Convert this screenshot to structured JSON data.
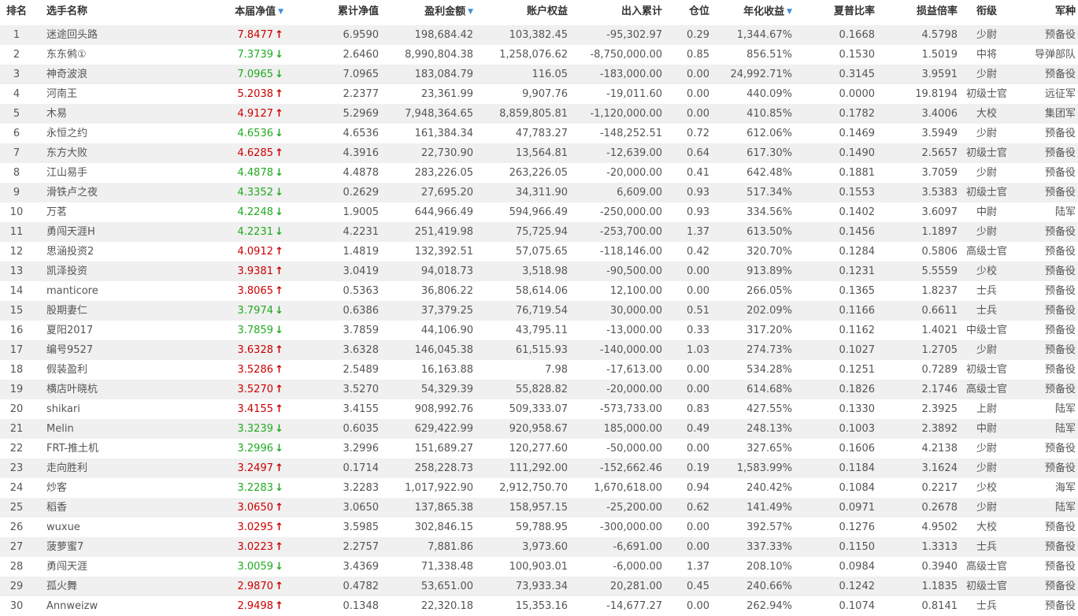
{
  "header": {
    "rank": "排名",
    "name": "选手名称",
    "week_nav": "本届净值",
    "cum_nav": "累计净值",
    "profit": "盈利金额",
    "equity": "账户权益",
    "flow": "出入累计",
    "position": "仓位",
    "annual": "年化收益",
    "sharpe": "夏普比率",
    "plr": "损益倍率",
    "title_rank": "衔级",
    "army": "军种"
  },
  "icons": {
    "sort": "sort-down-triangle-icon",
    "up": "up-arrow-icon",
    "down": "down-arrow-icon"
  },
  "colors": {
    "up": "#cc0000",
    "down": "#22aa22",
    "sort": "#3c8fd8",
    "alt_row": "#f0f0f0"
  },
  "rows": [
    {
      "rank": "1",
      "name": "迷途回头路",
      "week_nav": "7.8477",
      "trend": "up",
      "cum_nav": "6.9590",
      "profit": "198,684.42",
      "equity": "103,382.45",
      "flow": "-95,302.97",
      "position": "0.29",
      "annual": "1,344.67%",
      "sharpe": "0.1668",
      "plr": "4.5798",
      "title_rank": "少尉",
      "army": "预备役"
    },
    {
      "rank": "2",
      "name": "东东鸺①",
      "week_nav": "7.3739",
      "trend": "down",
      "cum_nav": "2.6460",
      "profit": "8,990,804.38",
      "equity": "1,258,076.62",
      "flow": "-8,750,000.00",
      "position": "0.85",
      "annual": "856.51%",
      "sharpe": "0.1530",
      "plr": "1.5019",
      "title_rank": "中将",
      "army": "导弹部队"
    },
    {
      "rank": "3",
      "name": "神奇波浪",
      "week_nav": "7.0965",
      "trend": "down",
      "cum_nav": "7.0965",
      "profit": "183,084.79",
      "equity": "116.05",
      "flow": "-183,000.00",
      "position": "0.00",
      "annual": "24,992.71%",
      "sharpe": "0.3145",
      "plr": "3.9591",
      "title_rank": "少尉",
      "army": "预备役"
    },
    {
      "rank": "4",
      "name": "河南王",
      "week_nav": "5.2038",
      "trend": "up",
      "cum_nav": "2.2377",
      "profit": "23,361.99",
      "equity": "9,907.76",
      "flow": "-19,011.60",
      "position": "0.00",
      "annual": "440.09%",
      "sharpe": "0.0000",
      "plr": "19.8194",
      "title_rank": "初级士官",
      "army": "远征军"
    },
    {
      "rank": "5",
      "name": "木易",
      "week_nav": "4.9127",
      "trend": "up",
      "cum_nav": "5.2969",
      "profit": "7,948,364.65",
      "equity": "8,859,805.81",
      "flow": "-1,120,000.00",
      "position": "0.00",
      "annual": "410.85%",
      "sharpe": "0.1782",
      "plr": "3.4006",
      "title_rank": "大校",
      "army": "集团军"
    },
    {
      "rank": "6",
      "name": "永恒之约",
      "week_nav": "4.6536",
      "trend": "down",
      "cum_nav": "4.6536",
      "profit": "161,384.34",
      "equity": "47,783.27",
      "flow": "-148,252.51",
      "position": "0.72",
      "annual": "612.06%",
      "sharpe": "0.1469",
      "plr": "3.5949",
      "title_rank": "少尉",
      "army": "预备役"
    },
    {
      "rank": "7",
      "name": "东方大败",
      "week_nav": "4.6285",
      "trend": "up",
      "cum_nav": "4.3916",
      "profit": "22,730.90",
      "equity": "13,564.81",
      "flow": "-12,639.00",
      "position": "0.64",
      "annual": "617.30%",
      "sharpe": "0.1490",
      "plr": "2.5657",
      "title_rank": "初级士官",
      "army": "预备役"
    },
    {
      "rank": "8",
      "name": "江山易手",
      "week_nav": "4.4878",
      "trend": "down",
      "cum_nav": "4.4878",
      "profit": "283,226.05",
      "equity": "263,226.05",
      "flow": "-20,000.00",
      "position": "0.41",
      "annual": "642.48%",
      "sharpe": "0.1881",
      "plr": "3.7059",
      "title_rank": "少尉",
      "army": "预备役"
    },
    {
      "rank": "9",
      "name": "滑铁卢之夜",
      "week_nav": "4.3352",
      "trend": "down",
      "cum_nav": "0.2629",
      "profit": "27,695.20",
      "equity": "34,311.90",
      "flow": "6,609.00",
      "position": "0.93",
      "annual": "517.34%",
      "sharpe": "0.1553",
      "plr": "3.5383",
      "title_rank": "初级士官",
      "army": "预备役"
    },
    {
      "rank": "10",
      "name": "万茗",
      "week_nav": "4.2248",
      "trend": "down",
      "cum_nav": "1.9005",
      "profit": "644,966.49",
      "equity": "594,966.49",
      "flow": "-250,000.00",
      "position": "0.93",
      "annual": "334.56%",
      "sharpe": "0.1402",
      "plr": "3.6097",
      "title_rank": "中尉",
      "army": "陆军"
    },
    {
      "rank": "11",
      "name": "勇闯天涯H",
      "week_nav": "4.2231",
      "trend": "down",
      "cum_nav": "4.2231",
      "profit": "251,419.98",
      "equity": "75,725.94",
      "flow": "-253,700.00",
      "position": "1.37",
      "annual": "613.50%",
      "sharpe": "0.1456",
      "plr": "1.1897",
      "title_rank": "少尉",
      "army": "预备役"
    },
    {
      "rank": "12",
      "name": "思涵投资2",
      "week_nav": "4.0912",
      "trend": "up",
      "cum_nav": "1.4819",
      "profit": "132,392.51",
      "equity": "57,075.65",
      "flow": "-118,146.00",
      "position": "0.42",
      "annual": "320.70%",
      "sharpe": "0.1284",
      "plr": "0.5806",
      "title_rank": "高级士官",
      "army": "预备役"
    },
    {
      "rank": "13",
      "name": "凯泽投资",
      "week_nav": "3.9381",
      "trend": "up",
      "cum_nav": "3.0419",
      "profit": "94,018.73",
      "equity": "3,518.98",
      "flow": "-90,500.00",
      "position": "0.00",
      "annual": "913.89%",
      "sharpe": "0.1231",
      "plr": "5.5559",
      "title_rank": "少校",
      "army": "预备役"
    },
    {
      "rank": "14",
      "name": "manticore",
      "week_nav": "3.8065",
      "trend": "up",
      "cum_nav": "0.5363",
      "profit": "36,806.22",
      "equity": "58,614.06",
      "flow": "12,100.00",
      "position": "0.00",
      "annual": "266.05%",
      "sharpe": "0.1365",
      "plr": "1.8237",
      "title_rank": "士兵",
      "army": "预备役"
    },
    {
      "rank": "15",
      "name": "股期妻仁",
      "week_nav": "3.7974",
      "trend": "down",
      "cum_nav": "0.6386",
      "profit": "37,379.25",
      "equity": "76,719.54",
      "flow": "30,000.00",
      "position": "0.51",
      "annual": "202.09%",
      "sharpe": "0.1166",
      "plr": "0.6611",
      "title_rank": "士兵",
      "army": "预备役"
    },
    {
      "rank": "16",
      "name": "夏阳2017",
      "week_nav": "3.7859",
      "trend": "down",
      "cum_nav": "3.7859",
      "profit": "44,106.90",
      "equity": "43,795.11",
      "flow": "-13,000.00",
      "position": "0.33",
      "annual": "317.20%",
      "sharpe": "0.1162",
      "plr": "1.4021",
      "title_rank": "中级士官",
      "army": "预备役"
    },
    {
      "rank": "17",
      "name": "编号9527",
      "week_nav": "3.6328",
      "trend": "up",
      "cum_nav": "3.6328",
      "profit": "146,045.38",
      "equity": "61,515.93",
      "flow": "-140,000.00",
      "position": "1.03",
      "annual": "274.73%",
      "sharpe": "0.1027",
      "plr": "1.2705",
      "title_rank": "少尉",
      "army": "预备役"
    },
    {
      "rank": "18",
      "name": "假装盈利",
      "week_nav": "3.5286",
      "trend": "up",
      "cum_nav": "2.5489",
      "profit": "16,163.88",
      "equity": "7.98",
      "flow": "-17,613.00",
      "position": "0.00",
      "annual": "534.28%",
      "sharpe": "0.1251",
      "plr": "0.7289",
      "title_rank": "初级士官",
      "army": "预备役"
    },
    {
      "rank": "19",
      "name": "横店叶晓杭",
      "week_nav": "3.5270",
      "trend": "up",
      "cum_nav": "3.5270",
      "profit": "54,329.39",
      "equity": "55,828.82",
      "flow": "-20,000.00",
      "position": "0.00",
      "annual": "614.68%",
      "sharpe": "0.1826",
      "plr": "2.1746",
      "title_rank": "高级士官",
      "army": "预备役"
    },
    {
      "rank": "20",
      "name": "shikari",
      "week_nav": "3.4155",
      "trend": "up",
      "cum_nav": "3.4155",
      "profit": "908,992.76",
      "equity": "509,333.07",
      "flow": "-573,733.00",
      "position": "0.83",
      "annual": "427.55%",
      "sharpe": "0.1330",
      "plr": "2.3925",
      "title_rank": "上尉",
      "army": "陆军"
    },
    {
      "rank": "21",
      "name": "Melin",
      "week_nav": "3.3239",
      "trend": "down",
      "cum_nav": "0.6035",
      "profit": "629,422.99",
      "equity": "920,958.67",
      "flow": "185,000.00",
      "position": "0.49",
      "annual": "248.13%",
      "sharpe": "0.1003",
      "plr": "2.3892",
      "title_rank": "中尉",
      "army": "陆军"
    },
    {
      "rank": "22",
      "name": "FRT-推土机",
      "week_nav": "3.2996",
      "trend": "down",
      "cum_nav": "3.2996",
      "profit": "151,689.27",
      "equity": "120,277.60",
      "flow": "-50,000.00",
      "position": "0.00",
      "annual": "327.65%",
      "sharpe": "0.1606",
      "plr": "4.2138",
      "title_rank": "少尉",
      "army": "预备役"
    },
    {
      "rank": "23",
      "name": "走向胜利",
      "week_nav": "3.2497",
      "trend": "up",
      "cum_nav": "0.1714",
      "profit": "258,228.73",
      "equity": "111,292.00",
      "flow": "-152,662.46",
      "position": "0.19",
      "annual": "1,583.99%",
      "sharpe": "0.1184",
      "plr": "3.1624",
      "title_rank": "少尉",
      "army": "预备役"
    },
    {
      "rank": "24",
      "name": "炒客",
      "week_nav": "3.2283",
      "trend": "down",
      "cum_nav": "3.2283",
      "profit": "1,017,922.90",
      "equity": "2,912,750.70",
      "flow": "1,670,618.00",
      "position": "0.94",
      "annual": "240.42%",
      "sharpe": "0.1084",
      "plr": "0.2217",
      "title_rank": "少校",
      "army": "海军"
    },
    {
      "rank": "25",
      "name": "稻香",
      "week_nav": "3.0650",
      "trend": "up",
      "cum_nav": "3.0650",
      "profit": "137,865.38",
      "equity": "158,957.15",
      "flow": "-25,200.00",
      "position": "0.62",
      "annual": "141.49%",
      "sharpe": "0.0971",
      "plr": "0.2678",
      "title_rank": "少尉",
      "army": "陆军"
    },
    {
      "rank": "26",
      "name": "wuxue",
      "week_nav": "3.0295",
      "trend": "up",
      "cum_nav": "3.5985",
      "profit": "302,846.15",
      "equity": "59,788.95",
      "flow": "-300,000.00",
      "position": "0.00",
      "annual": "392.57%",
      "sharpe": "0.1276",
      "plr": "4.9502",
      "title_rank": "大校",
      "army": "预备役"
    },
    {
      "rank": "27",
      "name": "菠萝蜜7",
      "week_nav": "3.0223",
      "trend": "up",
      "cum_nav": "2.2757",
      "profit": "7,881.86",
      "equity": "3,973.60",
      "flow": "-6,691.00",
      "position": "0.00",
      "annual": "337.33%",
      "sharpe": "0.1150",
      "plr": "1.3313",
      "title_rank": "士兵",
      "army": "预备役"
    },
    {
      "rank": "28",
      "name": "勇闯天涯",
      "week_nav": "3.0059",
      "trend": "down",
      "cum_nav": "3.4369",
      "profit": "71,338.48",
      "equity": "100,903.01",
      "flow": "-6,000.00",
      "position": "1.37",
      "annual": "208.10%",
      "sharpe": "0.0984",
      "plr": "0.3940",
      "title_rank": "高级士官",
      "army": "预备役"
    },
    {
      "rank": "29",
      "name": "孤火舞",
      "week_nav": "2.9870",
      "trend": "up",
      "cum_nav": "0.4782",
      "profit": "53,651.00",
      "equity": "73,933.34",
      "flow": "20,281.00",
      "position": "0.45",
      "annual": "240.66%",
      "sharpe": "0.1242",
      "plr": "1.1835",
      "title_rank": "初级士官",
      "army": "预备役"
    },
    {
      "rank": "30",
      "name": "Annweizw",
      "week_nav": "2.9498",
      "trend": "up",
      "cum_nav": "0.1348",
      "profit": "22,320.18",
      "equity": "15,353.16",
      "flow": "-14,677.27",
      "position": "0.00",
      "annual": "262.94%",
      "sharpe": "0.1074",
      "plr": "0.8141",
      "title_rank": "士兵",
      "army": "预备役"
    }
  ]
}
